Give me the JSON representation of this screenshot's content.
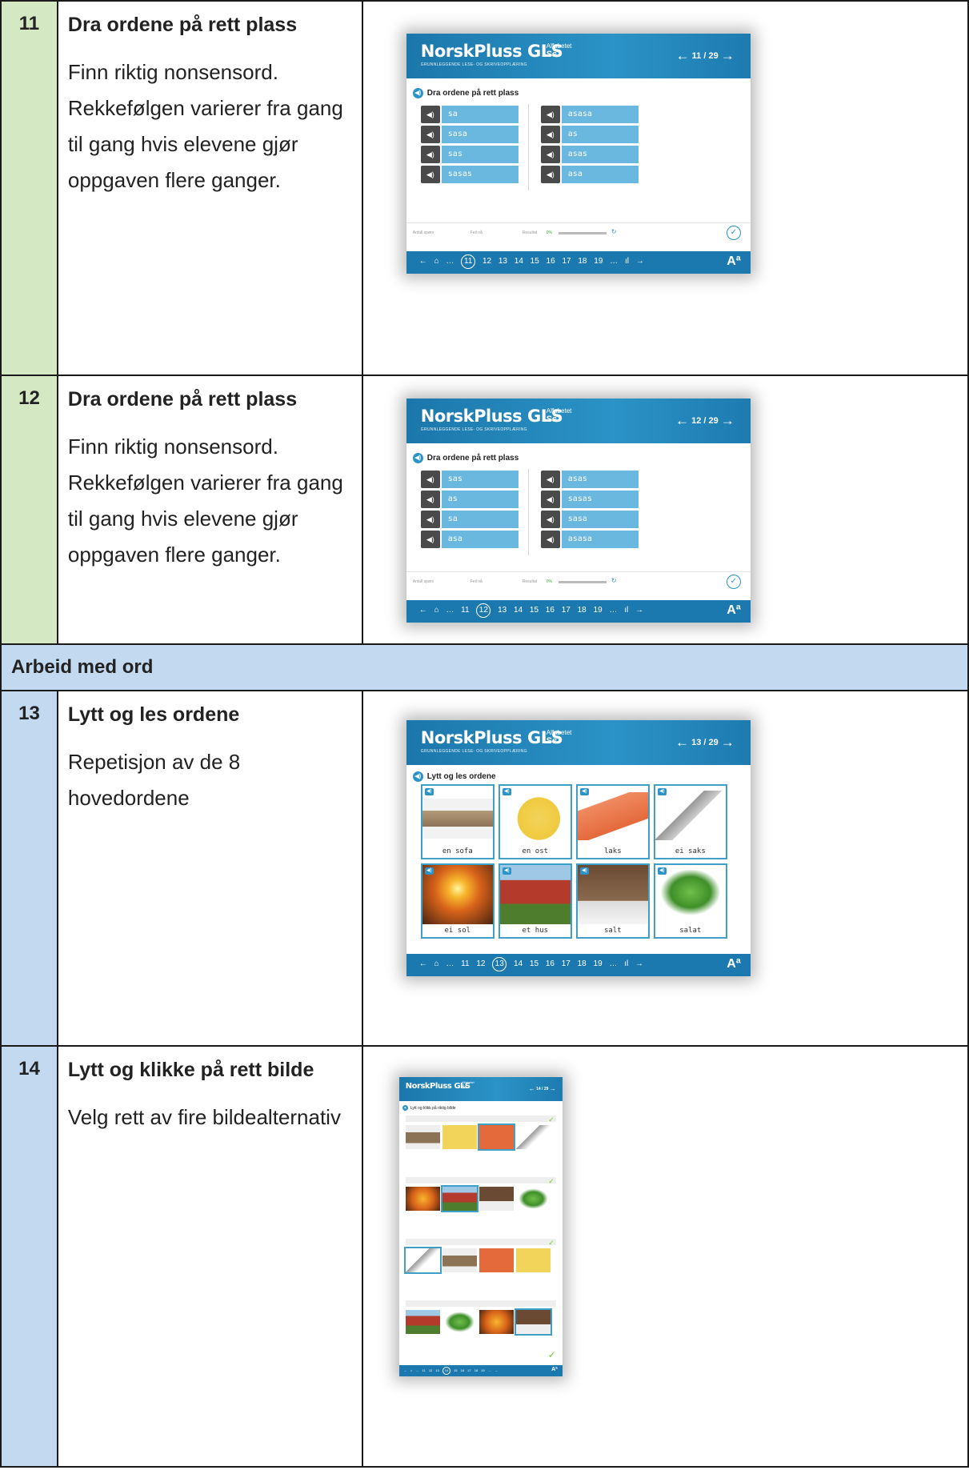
{
  "rows": [
    {
      "num": "11",
      "title": "Dra ordene på rett plass",
      "text": "Finn riktig nonsensord. Rekkefølgen varierer fra gang til gang hvis elevene gjør oppgaven flere ganger.",
      "app": {
        "brand": "NorskPluss GLS",
        "brand_sub": "GRUNNLEGGENDE LESE- OG SKRIVEOPPLÆRING",
        "topic_label": "Alfabetet",
        "topic": "Ss",
        "page": "11 / 29",
        "task": "Dra ordene på rett plass",
        "left_words": [
          "sa",
          "sasa",
          "sas",
          "sasas"
        ],
        "right_words": [
          "asasa",
          "as",
          "asas",
          "asa"
        ],
        "status": {
          "tries": "Antall spørs",
          "wrong": "Feil nå",
          "result": "Resultat",
          "percent": "0%"
        },
        "footer": "← ⌂ … (11) 12 13 14 15 16 17 18 19 … ıl →",
        "current": "11"
      }
    },
    {
      "num": "12",
      "title": "Dra ordene på rett plass",
      "text": "Finn riktig nonsensord. Rekkefølgen varierer fra gang til gang hvis elevene gjør oppgaven flere ganger.",
      "app": {
        "brand": "NorskPluss GLS",
        "brand_sub": "GRUNNLEGGENDE LESE- OG SKRIVEOPPLÆRING",
        "topic_label": "Alfabetet",
        "topic": "Ss",
        "page": "12 / 29",
        "task": "Dra ordene på rett plass",
        "left_words": [
          "sas",
          "as",
          "sa",
          "asa"
        ],
        "right_words": [
          "asas",
          "sasas",
          "sasa",
          "asasa"
        ],
        "status": {
          "tries": "Antall spørs",
          "wrong": "Feil nå",
          "result": "Resultat",
          "percent": "0%"
        },
        "current": "12"
      }
    },
    {
      "num": "13",
      "title": "Lytt og les ordene",
      "text": "Repetisjon av de 8 hovedordene",
      "app": {
        "brand": "NorskPluss GLS",
        "brand_sub": "GRUNNLEGGENDE LESE- OG SKRIVEOPPLÆRING",
        "topic_label": "Alfabetet",
        "topic": "Ss",
        "page": "13 / 29",
        "task": "Lytt og les ordene",
        "cards": [
          "en sofa",
          "en ost",
          "laks",
          "ei saks",
          "ei sol",
          "et hus",
          "salt",
          "salat"
        ],
        "current": "13"
      }
    },
    {
      "num": "14",
      "title": "Lytt og klikke på rett bilde",
      "text": "Velg rett av fire bildealternativ",
      "app": {
        "brand": "NorskPluss GLS",
        "topic_label": "Alfabetet",
        "topic": "Ss",
        "page": "14 / 29",
        "task": "Lytt og klikk på riktig bilde",
        "current": "14"
      }
    }
  ],
  "section": "Arbeid med ord",
  "colors": {
    "green": "#d5e8c4",
    "blue": "#c2d9ef",
    "app_blue": "#1c79af",
    "word_box": "#6ab8e0"
  }
}
